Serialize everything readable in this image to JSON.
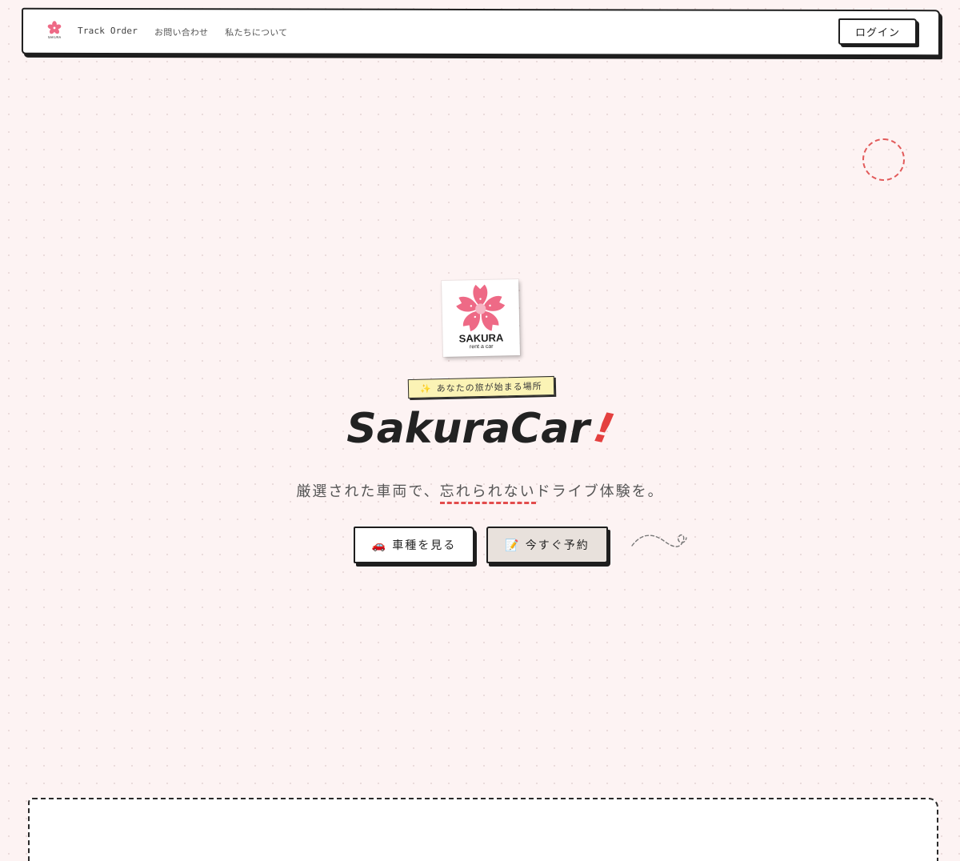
{
  "navbar": {
    "logo_text": "SAKURA",
    "links": [
      "Track Order",
      "お問い合わせ",
      "私たちについて"
    ],
    "login_label": "ログイン"
  },
  "hero": {
    "logo": {
      "brand": "SAKURA",
      "sub": "rent a car"
    },
    "tagline_icon": "✨",
    "tagline": "あなたの旅が始まる場所",
    "title": "SakuraCar",
    "title_mark": "!",
    "subtitle_before": "厳選された車両で、",
    "subtitle_highlight": "忘れられない",
    "subtitle_after": "ドライブ体験を。",
    "primary_button": {
      "icon": "🚗",
      "label": "車種を見る"
    },
    "secondary_button": {
      "icon": "📝",
      "label": "今すぐ予約"
    }
  },
  "colors": {
    "background": "#fdf3f3",
    "accent_red": "#e4403f",
    "sakura_pink": "#ee6a86",
    "tag_yellow": "#fbf3b5",
    "ink": "#1e1e1e"
  },
  "icons": [
    "sakura-logo-icon",
    "sparkles-icon",
    "car-icon",
    "memo-icon",
    "squiggle-arrow-icon"
  ]
}
